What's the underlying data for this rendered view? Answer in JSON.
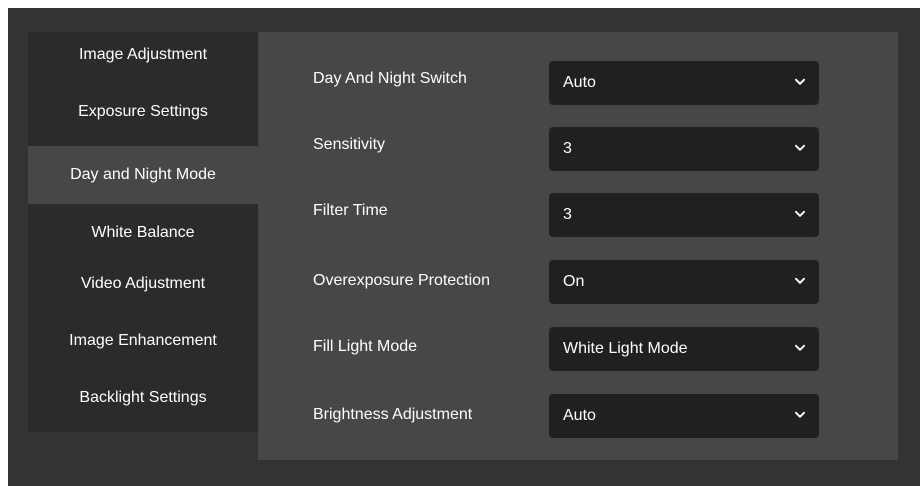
{
  "sidebar": {
    "items": [
      {
        "label": "Image Adjustment",
        "active": false
      },
      {
        "label": "Exposure Settings",
        "active": false
      },
      {
        "label": "Day and Night Mode",
        "active": true
      },
      {
        "label": "White Balance",
        "active": false
      },
      {
        "label": "Video Adjustment",
        "active": false
      },
      {
        "label": "Image Enhancement",
        "active": false
      },
      {
        "label": "Backlight Settings",
        "active": false
      }
    ]
  },
  "settings": {
    "day_night_switch": {
      "label": "Day And Night Switch",
      "value": "Auto"
    },
    "sensitivity": {
      "label": "Sensitivity",
      "value": "3"
    },
    "filter_time": {
      "label": "Filter Time",
      "value": "3"
    },
    "overexposure_protection": {
      "label": "Overexposure Protection",
      "value": "On"
    },
    "fill_light_mode": {
      "label": "Fill Light Mode",
      "value": "White Light Mode"
    },
    "brightness_adjustment": {
      "label": "Brightness Adjustment",
      "value": "Auto"
    }
  },
  "colors": {
    "background": "#333333",
    "sidebar_item": "#2b2b2b",
    "active_item": "#474747",
    "panel": "#474747",
    "select": "#202020",
    "text": "#ffffff"
  },
  "icons": {
    "dropdown": "chevron-down-icon"
  }
}
